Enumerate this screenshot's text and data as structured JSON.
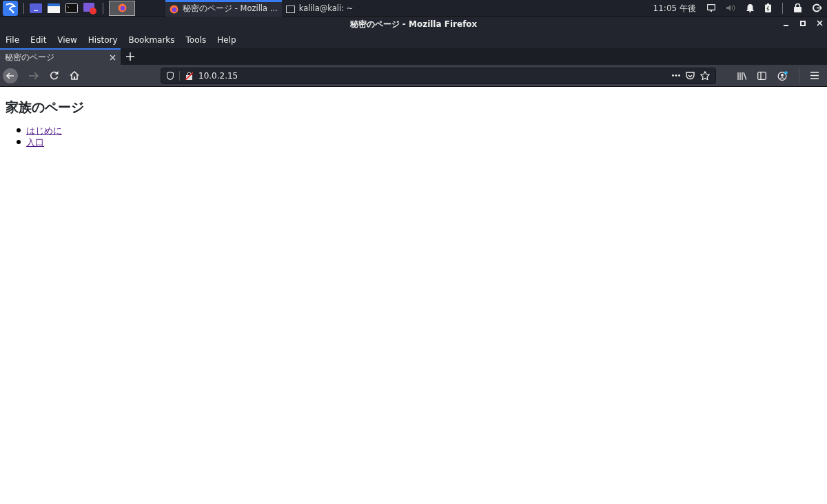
{
  "taskbar": {
    "tasks": [
      {
        "label": "秘密のページ - Mozilla ...",
        "selected": true,
        "kind": "browser"
      },
      {
        "label": "kalila@kali: ~",
        "selected": false,
        "kind": "terminal"
      }
    ],
    "clock": "11:05 午後"
  },
  "window": {
    "title": "秘密のページ - Mozilla Firefox"
  },
  "menu": [
    "File",
    "Edit",
    "View",
    "History",
    "Bookmarks",
    "Tools",
    "Help"
  ],
  "tabs": [
    {
      "label": "秘密のページ",
      "selected": true
    }
  ],
  "address_bar": {
    "value": "10.0.2.15"
  },
  "page": {
    "heading": "家族のページ",
    "links": [
      "はじめに",
      "入口"
    ]
  }
}
